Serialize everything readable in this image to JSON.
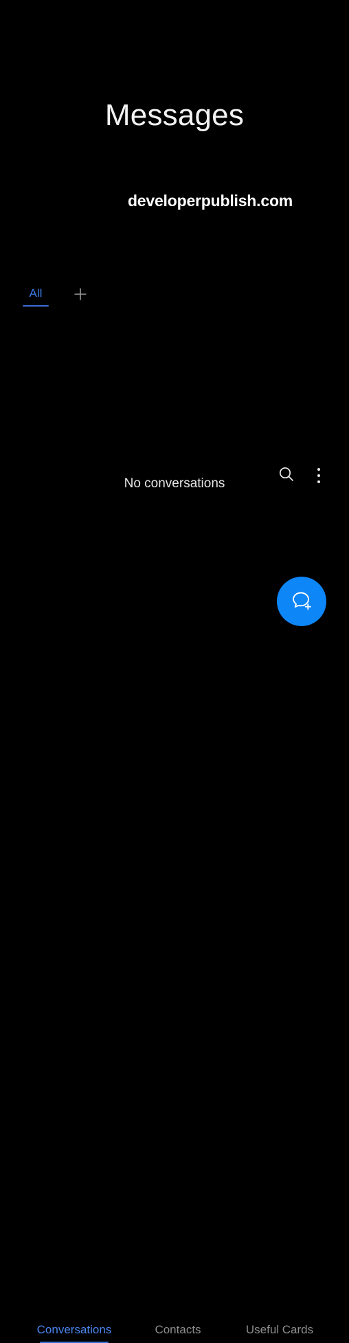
{
  "app": {
    "title": "Messages",
    "watermark": "developerpublish.com"
  },
  "toolbar": {
    "search_icon": "search-icon",
    "overflow_icon": "more-vertical-icon"
  },
  "categories": {
    "tabs": [
      {
        "label": "All",
        "active": true
      }
    ],
    "add_icon": "plus-icon"
  },
  "content": {
    "empty_message": "No conversations"
  },
  "fab": {
    "icon": "new-conversation-icon"
  },
  "bottom_nav": {
    "items": [
      {
        "label": "Conversations",
        "active": true
      },
      {
        "label": "Contacts",
        "active": false
      },
      {
        "label": "Useful Cards",
        "active": false
      }
    ]
  },
  "colors": {
    "background": "#000000",
    "accent_blue": "#3b7ae8",
    "fab_blue": "#0d86f8",
    "inactive_grey": "#8d8d8d",
    "text_primary": "#f2f2f2"
  }
}
